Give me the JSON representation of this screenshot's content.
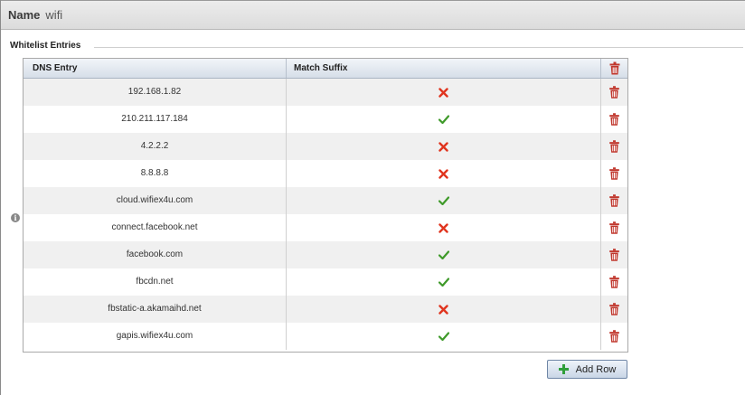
{
  "name_field": {
    "label": "Name",
    "value": "wifi"
  },
  "section": {
    "title": "Whitelist Entries"
  },
  "table": {
    "columns": {
      "dns": "DNS Entry",
      "match": "Match Suffix"
    },
    "rows": [
      {
        "dns": "192.168.1.82",
        "match_suffix": false
      },
      {
        "dns": "210.211.117.184",
        "match_suffix": true
      },
      {
        "dns": "4.2.2.2",
        "match_suffix": false
      },
      {
        "dns": "8.8.8.8",
        "match_suffix": false
      },
      {
        "dns": "cloud.wifiex4u.com",
        "match_suffix": true
      },
      {
        "dns": "connect.facebook.net",
        "match_suffix": false
      },
      {
        "dns": "facebook.com",
        "match_suffix": true
      },
      {
        "dns": "fbcdn.net",
        "match_suffix": true
      },
      {
        "dns": "fbstatic-a.akamaihd.net",
        "match_suffix": false
      },
      {
        "dns": "gapis.wifiex4u.com",
        "match_suffix": true
      }
    ]
  },
  "buttons": {
    "add_row": "Add Row"
  },
  "icons": {
    "info": "info-icon",
    "delete": "trash-icon",
    "true_mark": "check-icon",
    "false_mark": "cross-icon",
    "add": "plus-icon"
  },
  "colors": {
    "check": "#3f9a2a",
    "cross": "#e0341e",
    "trash": "#c0362c",
    "add": "#2f9e3a"
  }
}
